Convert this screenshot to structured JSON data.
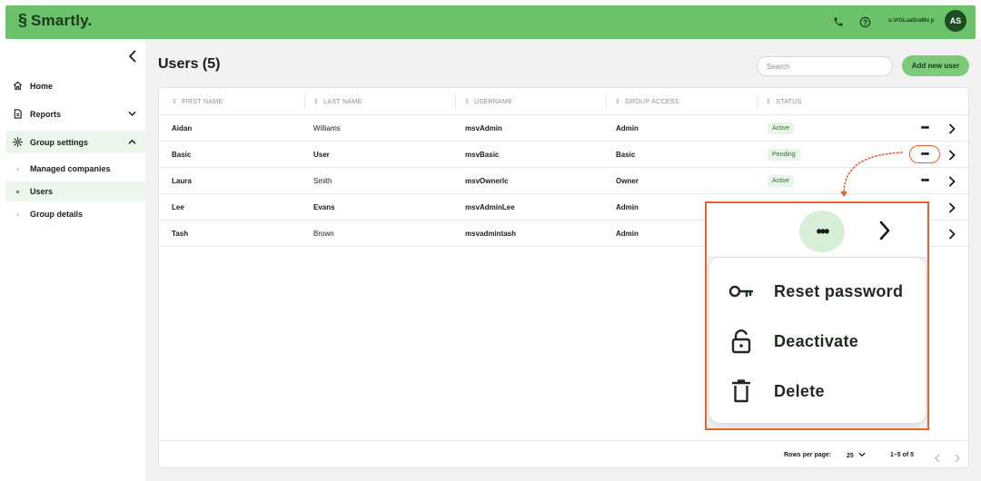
{
  "app": {
    "logo_text": "Smartly.",
    "user_name": "u.VrGLuaSraMo p",
    "avatar_initials": "AS",
    "accent_color": "#6cc26b",
    "highlight_color": "#e7622c"
  },
  "sidebar": {
    "items": [
      {
        "label": "Home",
        "icon": "home-icon"
      },
      {
        "label": "Reports",
        "icon": "report-icon"
      },
      {
        "label": "Group settings",
        "icon": "gear-icon"
      }
    ],
    "sub_items": [
      {
        "label": "Managed companies"
      },
      {
        "label": "Users"
      },
      {
        "label": "Group details"
      }
    ]
  },
  "main": {
    "title": "Users (5)",
    "search_placeholder": "Search",
    "add_button": "Add new user"
  },
  "table": {
    "columns": [
      "FIRST NAME",
      "LAST NAME",
      "USERNAME",
      "GROUP ACCESS",
      "STATUS"
    ],
    "rows": [
      {
        "first": "Aidan",
        "last": "Williams",
        "username": "msvAdmin",
        "access": "Admin",
        "status": "Active"
      },
      {
        "first": "Basic",
        "last": "User",
        "username": "msvBasic",
        "access": "Basic",
        "status": "Pending"
      },
      {
        "first": "Laura",
        "last": "Smith",
        "username": "msvOwnerlc",
        "access": "Owner",
        "status": "Active"
      },
      {
        "first": "Lee",
        "last": "Evans",
        "username": "msvAdminLee",
        "access": "Admin",
        "status": ""
      },
      {
        "first": "Tash",
        "last": "Brown",
        "username": "msvadmintash",
        "access": "Admin",
        "status": ""
      }
    ],
    "more_glyph": "•••"
  },
  "footer": {
    "rows_per_page_label": "Rows per page:",
    "rows_per_page_value": "25",
    "range": "1–5 of 5"
  },
  "menu": {
    "more_glyph": "•••",
    "items": [
      {
        "label": "Reset password",
        "icon": "key-icon"
      },
      {
        "label": "Deactivate",
        "icon": "unlock-icon"
      },
      {
        "label": "Delete",
        "icon": "trash-icon"
      }
    ]
  }
}
